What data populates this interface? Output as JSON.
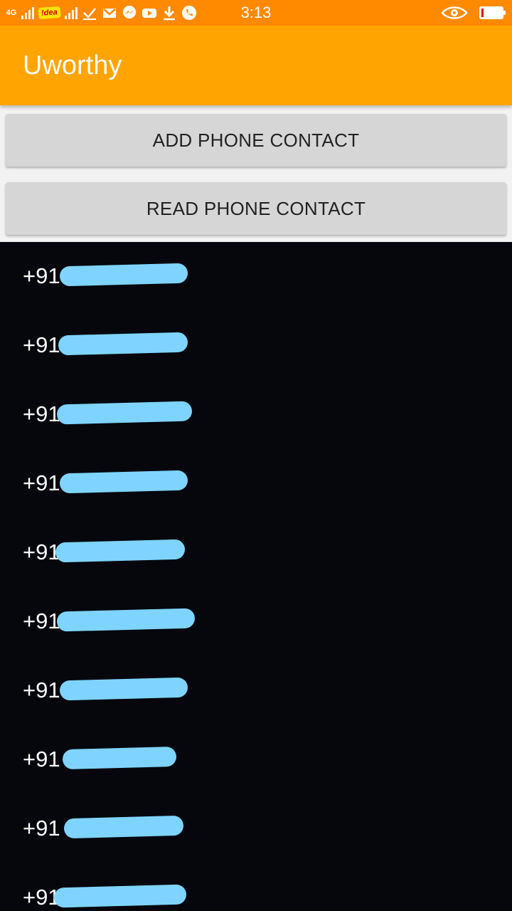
{
  "status_bar": {
    "network": "4G",
    "carrier_badge": "!dea",
    "time": "3:13",
    "icons": [
      "signal-icon",
      "check-icon",
      "gmail-icon",
      "messenger-icon",
      "youtube-icon",
      "download-icon",
      "whatsapp-icon",
      "eye-icon"
    ],
    "battery_level": 0.12
  },
  "app_bar": {
    "title": "Uworthy"
  },
  "buttons": {
    "add": "ADD PHONE CONTACT",
    "read": "READ PHONE CONTACT"
  },
  "contacts": [
    "+91",
    "+91",
    "+91",
    "+91",
    "+91",
    "+91",
    "+91",
    "+91",
    "+91",
    "+91"
  ],
  "colors": {
    "status_bar": "#ff8a00",
    "app_bar": "#ffa400",
    "list_background": "#05070d",
    "redaction": "#7fd4ff"
  }
}
